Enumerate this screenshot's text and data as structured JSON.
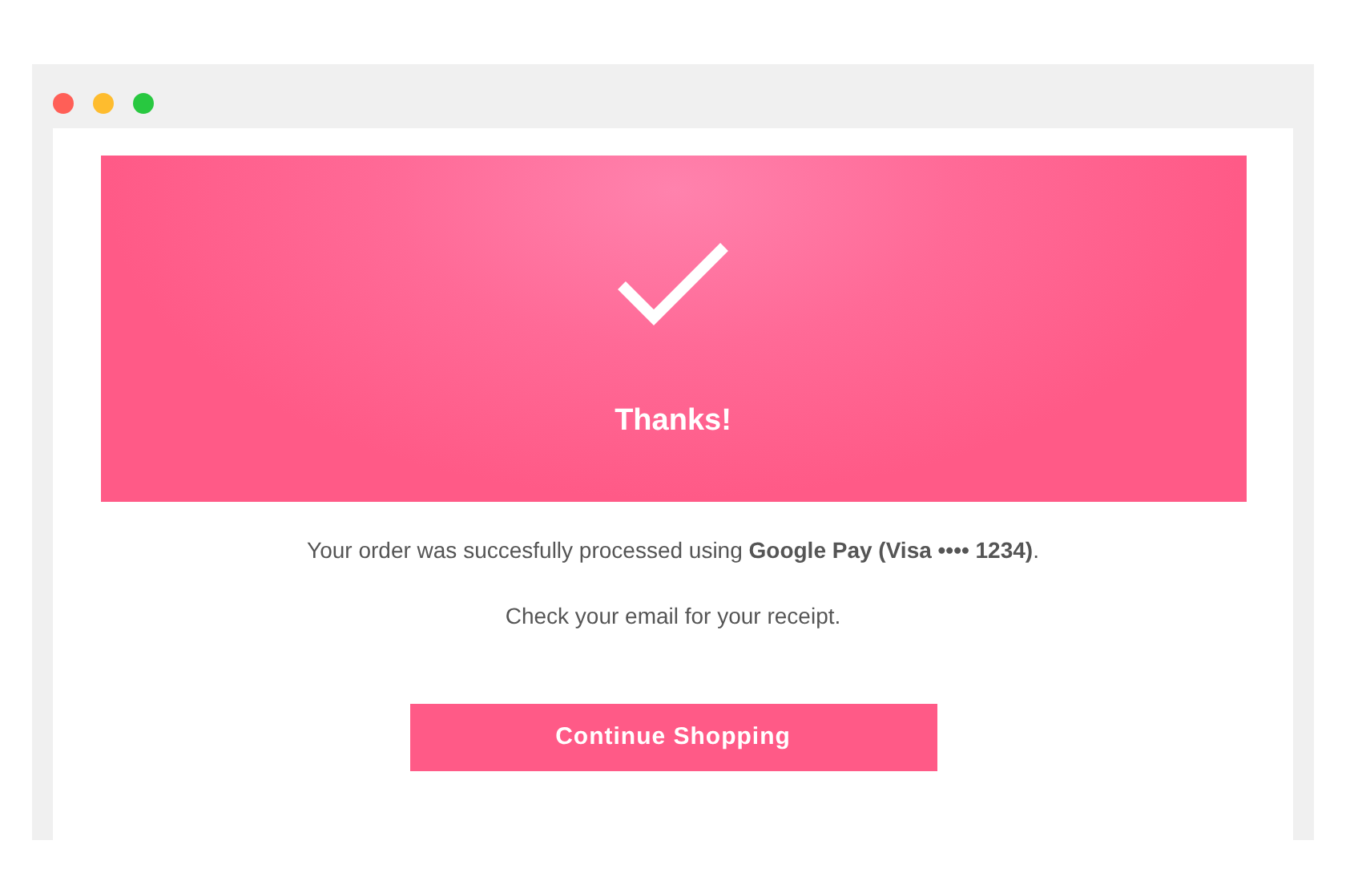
{
  "banner": {
    "title": "Thanks!"
  },
  "message": "Your order was succesfully processed using **Google Pay (Visa •••• 1234)**.",
  "note": "Check your email for your receipt.",
  "button": {
    "label": "Continue Shopping"
  }
}
